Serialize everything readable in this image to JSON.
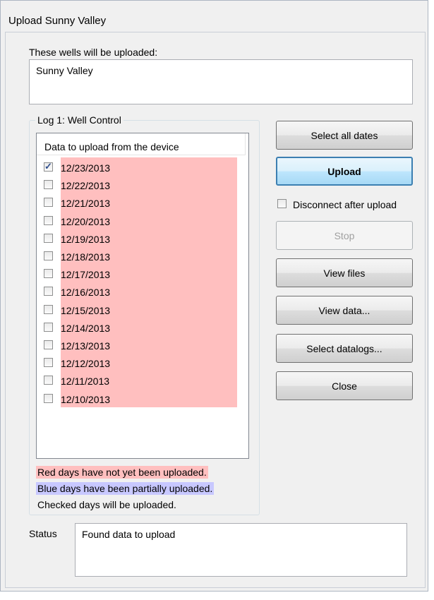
{
  "window": {
    "title": "Upload Sunny Valley"
  },
  "wells": {
    "label": "These wells will be uploaded:",
    "items": [
      "Sunny Valley"
    ]
  },
  "log_group": {
    "caption": "Log 1:  Well Control",
    "list_header": "Data to upload from the device",
    "dates": [
      {
        "label": "12/23/2013",
        "checked": true
      },
      {
        "label": "12/22/2013",
        "checked": false
      },
      {
        "label": "12/21/2013",
        "checked": false
      },
      {
        "label": "12/20/2013",
        "checked": false
      },
      {
        "label": "12/19/2013",
        "checked": false
      },
      {
        "label": "12/18/2013",
        "checked": false
      },
      {
        "label": "12/17/2013",
        "checked": false
      },
      {
        "label": "12/16/2013",
        "checked": false
      },
      {
        "label": "12/15/2013",
        "checked": false
      },
      {
        "label": "12/14/2013",
        "checked": false
      },
      {
        "label": "12/13/2013",
        "checked": false
      },
      {
        "label": "12/12/2013",
        "checked": false
      },
      {
        "label": "12/11/2013",
        "checked": false
      },
      {
        "label": "12/10/2013",
        "checked": false
      }
    ],
    "legend": {
      "red": "Red days have not yet been uploaded.",
      "blue": "Blue days have been partially uploaded.",
      "checked": "Checked days will be uploaded."
    }
  },
  "buttons": {
    "select_all_dates": "Select all dates",
    "upload": "Upload",
    "disconnect_after_upload": "Disconnect after upload",
    "stop": "Stop",
    "view_files": "View files",
    "view_data": "View data...",
    "select_datalogs": "Select datalogs...",
    "close": "Close"
  },
  "status": {
    "label": "Status",
    "text": "Found data to upload"
  },
  "colors": {
    "not_uploaded": "#ffbfbf",
    "partially_uploaded": "#c8c8ff",
    "accent": "#3c7fb1"
  }
}
